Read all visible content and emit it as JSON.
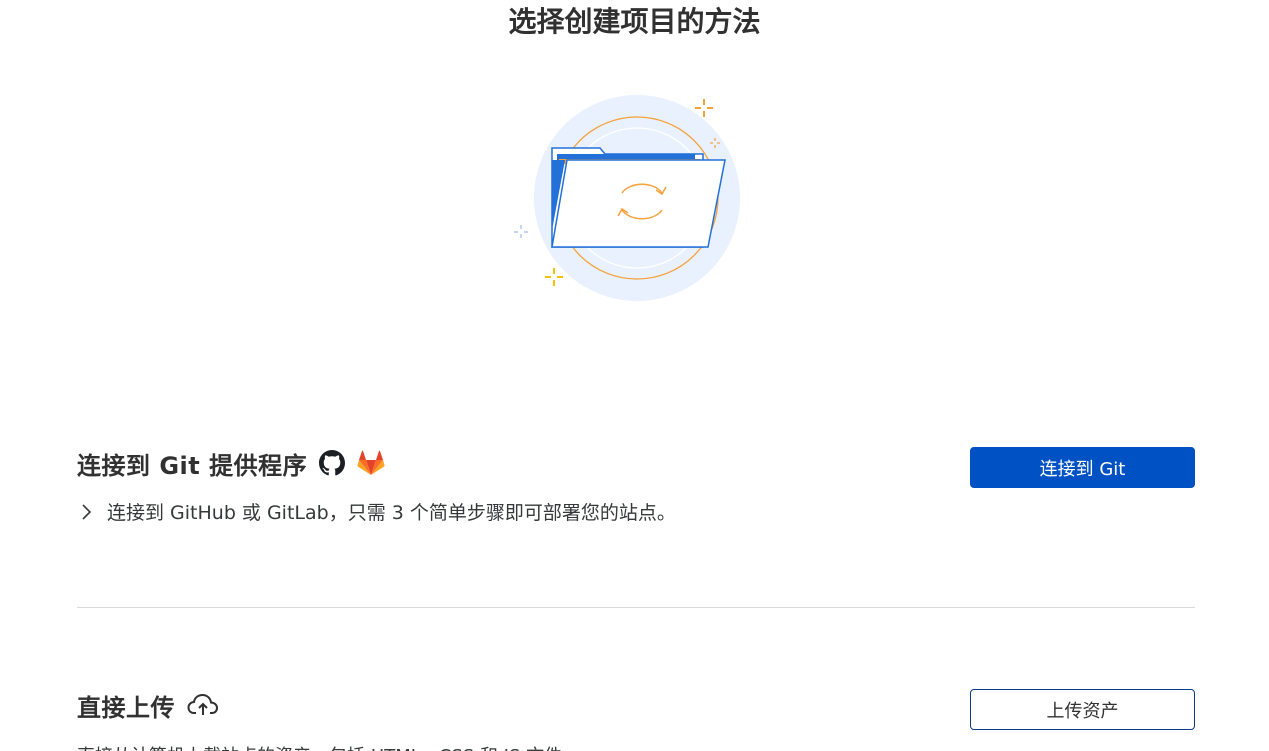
{
  "page": {
    "title": "选择创建项目的方法"
  },
  "hero": {
    "illustration": "folder-sync-icon"
  },
  "git_section": {
    "title": "连接到 Git 提供程序",
    "icons": [
      "github-icon",
      "gitlab-icon"
    ],
    "description": "连接到 GitHub 或 GitLab，只需 3 个简单步骤即可部署您的站点。",
    "button_label": "连接到 Git"
  },
  "upload_section": {
    "title": "直接上传",
    "icon": "cloud-upload-icon",
    "description": "直接从计算机上载站点的资产，包括 HTML、CSS 和 JS 文件。",
    "button_label": "上传资产"
  },
  "colors": {
    "primary": "#0051c3",
    "accent_orange": "#f6a13a",
    "accent_yellow": "#f2c200",
    "hero_bg": "#e8f1fd"
  }
}
